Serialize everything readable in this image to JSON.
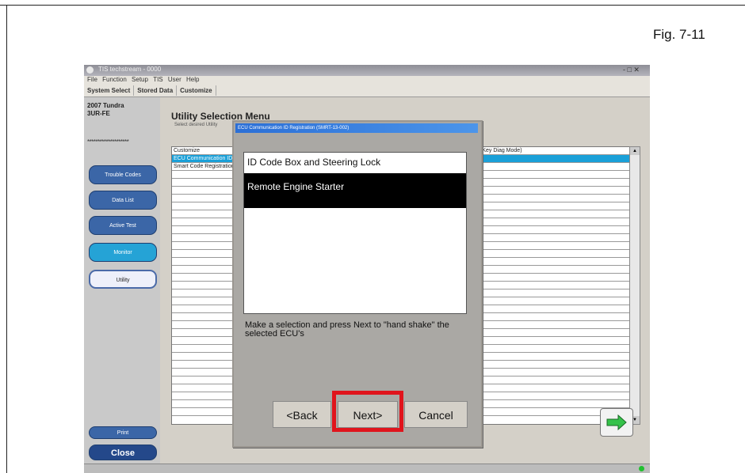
{
  "figure_label": "Fig. 7-11",
  "window": {
    "title": "TIS techstream - 0000",
    "controls": "- □ ✕"
  },
  "menu": [
    "File",
    "Function",
    "Setup",
    "TIS",
    "User",
    "Help"
  ],
  "tabs": [
    "System Select",
    "Stored Data",
    "Customize"
  ],
  "vehicle": "2007 Tundra\n3UR-FE",
  "sidebar": {
    "stars": "********************",
    "buttons": [
      "Trouble Codes",
      "Data List",
      "Active Test",
      "Monitor",
      "Utility"
    ],
    "print_label": "Print",
    "close_label": "Close"
  },
  "main": {
    "title": "Utility Selection Menu",
    "subtitle": "Select desired Utility",
    "list": [
      "Customize",
      "ECU Communication ID Registration",
      "Smart Code Registration"
    ],
    "right_text": "ck(Key Diag Mode)"
  },
  "dialog": {
    "title": "ECU Communication ID Registration (SMRT-13-002)",
    "items": [
      "ID Code Box and Steering Lock",
      "Remote Engine Starter"
    ],
    "selected_index": 1,
    "message": "Make a selection and press Next to \"hand shake\" the selected ECU's",
    "back_label": "<Back",
    "next_label": "Next>",
    "cancel_label": "Cancel"
  },
  "statusbar": {
    "left": "",
    "mid": "",
    "right1": "",
    "right2": ""
  },
  "colors": {
    "highlight": "#e0141c",
    "dialog_title": "#2b6fd6",
    "selection": "#1aa0d8",
    "sidebar_button": "#3b66a7"
  }
}
